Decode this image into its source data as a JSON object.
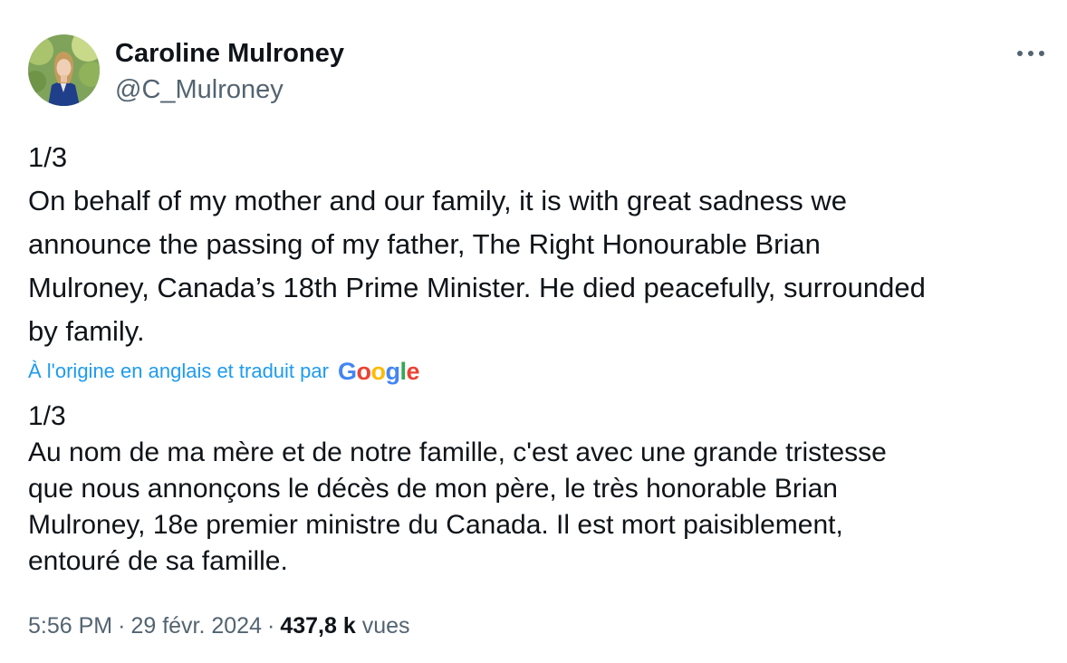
{
  "author": {
    "display_name": "Caroline Mulroney",
    "handle": "@C_Mulroney"
  },
  "icons": {
    "more": "more-horizontal-icon",
    "avatar": "profile-photo"
  },
  "original_lines": [
    "1/3",
    "On behalf of my mother and our family, it is with great sadness we",
    "announce the passing of my father, The Right Honourable Brian",
    "Mulroney, Canada’s 18th Prime Minister. He died peacefully, surrounded",
    "by family."
  ],
  "translation": {
    "note": "À l'origine en anglais et traduit par",
    "provider": "Google",
    "link_color": "#1d9bf0"
  },
  "translated_lines": [
    "1/3",
    "Au nom de ma mère et de notre famille, c'est avec une grande tristesse",
    "que nous annonçons le décès de mon père, le très honorable Brian",
    "Mulroney, 18e premier ministre du Canada. Il est mort paisiblement,",
    "entouré de sa famille."
  ],
  "meta": {
    "time": "5:56 PM",
    "date": "29 févr. 2024",
    "separator": "·",
    "views_count": "437,8 k",
    "views_label": "vues"
  },
  "colors": {
    "text": "#0f1419",
    "secondary": "#536471",
    "google_blue": "#4285f4",
    "google_red": "#ea4335",
    "google_yellow": "#fbbc05",
    "google_green": "#34a853"
  }
}
